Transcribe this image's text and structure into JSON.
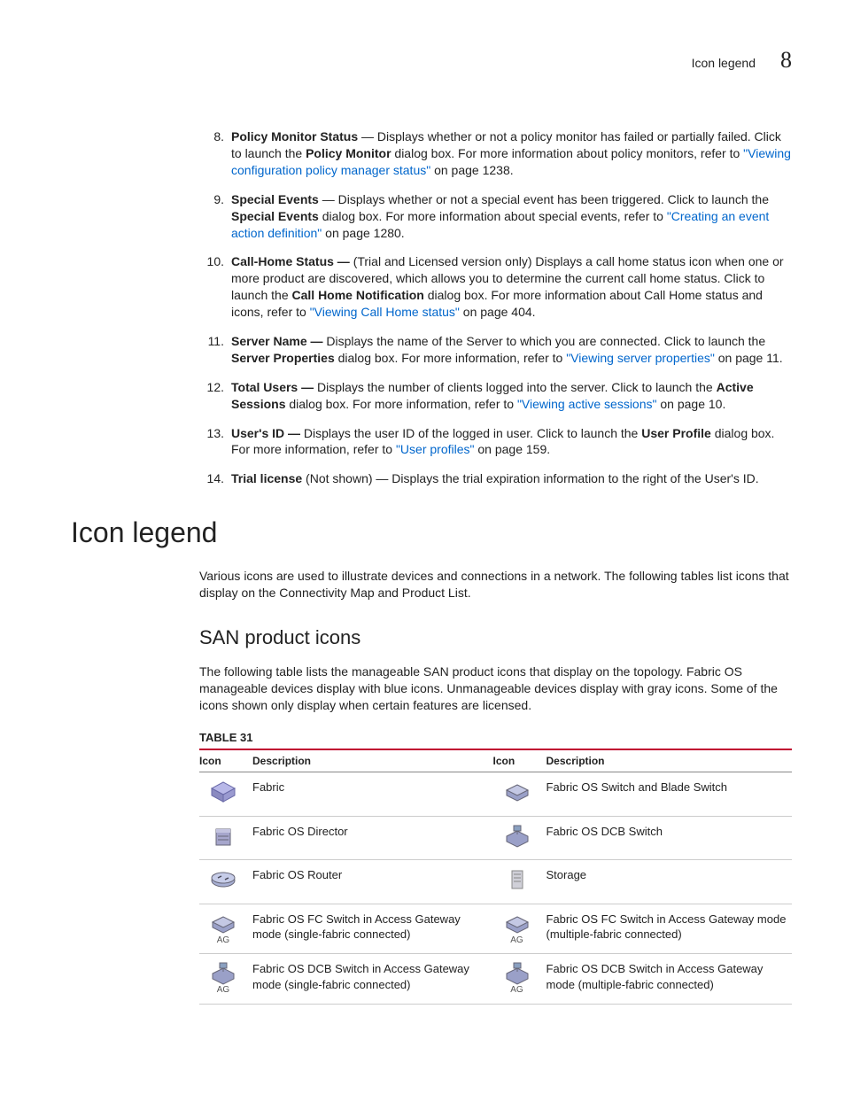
{
  "header": {
    "title": "Icon legend",
    "chapter": "8"
  },
  "list": [
    {
      "n": "8.",
      "lead": "Policy Monitor Status",
      "text1": " — Displays whether or not a policy monitor has failed or partially failed. Click to launch the ",
      "bold1": "Policy Monitor",
      "text2": " dialog box. For more information about policy monitors, refer to ",
      "link": "\"Viewing configuration policy manager status\"",
      "tail": " on page 1238."
    },
    {
      "n": "9.",
      "lead": "Special Events",
      "text1": " — Displays whether or not a special event has been triggered. Click to launch the ",
      "bold1": "Special Events",
      "text2": " dialog box. For more information about special events, refer to ",
      "link": "\"Creating an event action definition\"",
      "tail": " on page 1280."
    },
    {
      "n": "10.",
      "lead": "Call-Home Status —",
      "text1": " (Trial and Licensed version only) Displays a call home status icon when one or more product are discovered, which allows you to determine the current call home status. Click to launch the ",
      "bold1": "Call Home Notification",
      "text2": " dialog box. For more information about Call Home status and icons, refer to ",
      "link": "\"Viewing Call Home status\"",
      "tail": " on page 404."
    },
    {
      "n": "11.",
      "lead": "Server Name —",
      "text1": " Displays the name of the Server to which you are connected. Click to launch the ",
      "bold1": "Server Properties",
      "text2": " dialog box. For more information, refer to ",
      "link": "\"Viewing server properties\"",
      "tail": " on page 11."
    },
    {
      "n": "12.",
      "lead": "Total Users —",
      "text1": " Displays the number of clients logged into the server. Click to launch the ",
      "bold1": "Active Sessions",
      "text2": " dialog box. For more information, refer to ",
      "link": "\"Viewing active sessions\"",
      "tail": " on page 10."
    },
    {
      "n": "13.",
      "lead": "User's ID —",
      "text1": " Displays the user ID of the logged in user. Click to launch the ",
      "bold1": "User Profile",
      "text2": " dialog box. For more information, refer to ",
      "link": "\"User profiles\"",
      "tail": " on page 159."
    },
    {
      "n": "14.",
      "lead": "Trial license",
      "text1": " (Not shown) — Displays the trial expiration information to the right of the User's ID.",
      "bold1": "",
      "text2": "",
      "link": "",
      "tail": ""
    }
  ],
  "section": {
    "heading": "Icon legend",
    "intro": "Various icons are used to illustrate devices and connections in a network. The following tables list icons that display on the Connectivity Map and Product List.",
    "subheading": "SAN product icons",
    "subintro": "The following table lists the manageable SAN product icons that display on the topology. Fabric OS manageable devices display with blue icons. Unmanageable devices display with gray icons. Some of the icons shown only display when certain features are licensed.",
    "table_caption": "TABLE 31",
    "th_icon": "Icon",
    "th_desc": "Description"
  },
  "table_rows": [
    {
      "d1": "Fabric",
      "d2": "Fabric OS Switch and Blade Switch",
      "ag1": false,
      "ag2": false
    },
    {
      "d1": "Fabric OS Director",
      "d2": "Fabric OS DCB Switch",
      "ag1": false,
      "ag2": false
    },
    {
      "d1": "Fabric OS Router",
      "d2": "Storage",
      "ag1": false,
      "ag2": false
    },
    {
      "d1": "Fabric OS FC Switch in Access Gateway mode (single-fabric connected)",
      "d2": "Fabric OS FC Switch in Access Gateway mode (multiple-fabric connected)",
      "ag1": true,
      "ag2": true
    },
    {
      "d1": "Fabric OS DCB Switch in Access Gateway mode (single-fabric connected)",
      "d2": "Fabric OS DCB Switch in Access Gateway mode (multiple-fabric connected)",
      "ag1": true,
      "ag2": true
    }
  ],
  "ag_label": "AG"
}
